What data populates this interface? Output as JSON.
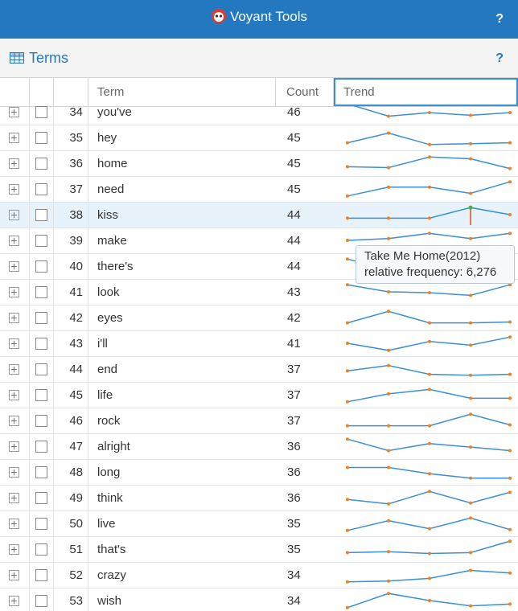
{
  "app": {
    "title": "Voyant Tools",
    "help": "?"
  },
  "panel": {
    "title": "Terms",
    "help": "?"
  },
  "columns": {
    "term": "Term",
    "count": "Count",
    "trend": "Trend"
  },
  "colors": {
    "brand": "#2378c0",
    "spark_line": "#3a8fd8",
    "spark_dot": "#f07f1e",
    "highlight_point": "#4caf50",
    "highlight_stem": "#e8481f"
  },
  "rows": [
    {
      "num": "34",
      "term": "you've",
      "count": "46",
      "trend": [
        0.95,
        0.25,
        0.45,
        0.3,
        0.45
      ]
    },
    {
      "num": "35",
      "term": "hey",
      "count": "45",
      "trend": [
        0.2,
        0.75,
        0.1,
        0.15,
        0.2
      ]
    },
    {
      "num": "36",
      "term": "home",
      "count": "45",
      "trend": [
        0.3,
        0.25,
        0.85,
        0.75,
        0.2
      ]
    },
    {
      "num": "37",
      "term": "need",
      "count": "45",
      "trend": [
        0.1,
        0.6,
        0.6,
        0.25,
        0.9
      ]
    },
    {
      "num": "38",
      "term": "kiss",
      "count": "44",
      "trend": [
        0.3,
        0.3,
        0.3,
        0.9,
        0.5
      ],
      "highlight": 3,
      "selected": true
    },
    {
      "num": "39",
      "term": "make",
      "count": "44",
      "trend": [
        0.5,
        0.6,
        0.9,
        0.6,
        0.9
      ]
    },
    {
      "num": "40",
      "term": "there's",
      "count": "44",
      "trend": [
        0.9,
        0.3,
        0.4,
        0.5,
        0.3
      ]
    },
    {
      "num": "41",
      "term": "look",
      "count": "43",
      "trend": [
        0.9,
        0.5,
        0.45,
        0.3,
        0.9
      ]
    },
    {
      "num": "42",
      "term": "eyes",
      "count": "42",
      "trend": [
        0.2,
        0.85,
        0.2,
        0.2,
        0.25
      ]
    },
    {
      "num": "43",
      "term": "i'll",
      "count": "41",
      "trend": [
        0.5,
        0.1,
        0.6,
        0.4,
        0.85
      ]
    },
    {
      "num": "44",
      "term": "end",
      "count": "37",
      "trend": [
        0.4,
        0.7,
        0.2,
        0.15,
        0.2
      ]
    },
    {
      "num": "45",
      "term": "life",
      "count": "37",
      "trend": [
        0.1,
        0.55,
        0.8,
        0.3,
        0.3
      ]
    },
    {
      "num": "46",
      "term": "rock",
      "count": "37",
      "trend": [
        0.2,
        0.2,
        0.2,
        0.85,
        0.25
      ]
    },
    {
      "num": "47",
      "term": "alright",
      "count": "36",
      "trend": [
        0.9,
        0.25,
        0.65,
        0.45,
        0.25
      ]
    },
    {
      "num": "48",
      "term": "long",
      "count": "36",
      "trend": [
        0.75,
        0.75,
        0.4,
        0.15,
        0.15
      ]
    },
    {
      "num": "49",
      "term": "think",
      "count": "36",
      "trend": [
        0.4,
        0.15,
        0.85,
        0.2,
        0.8
      ]
    },
    {
      "num": "50",
      "term": "live",
      "count": "35",
      "trend": [
        0.1,
        0.65,
        0.2,
        0.8,
        0.15
      ]
    },
    {
      "num": "51",
      "term": "that's",
      "count": "35",
      "trend": [
        0.3,
        0.35,
        0.25,
        0.3,
        0.95
      ]
    },
    {
      "num": "52",
      "term": "crazy",
      "count": "34",
      "trend": [
        0.1,
        0.15,
        0.3,
        0.75,
        0.6
      ]
    },
    {
      "num": "53",
      "term": "wish",
      "count": "34",
      "trend": [
        0.1,
        0.9,
        0.5,
        0.2,
        0.3
      ]
    }
  ],
  "tooltip": {
    "title": "Take Me Home(2012)",
    "text": "relative frequency: 6,276"
  }
}
